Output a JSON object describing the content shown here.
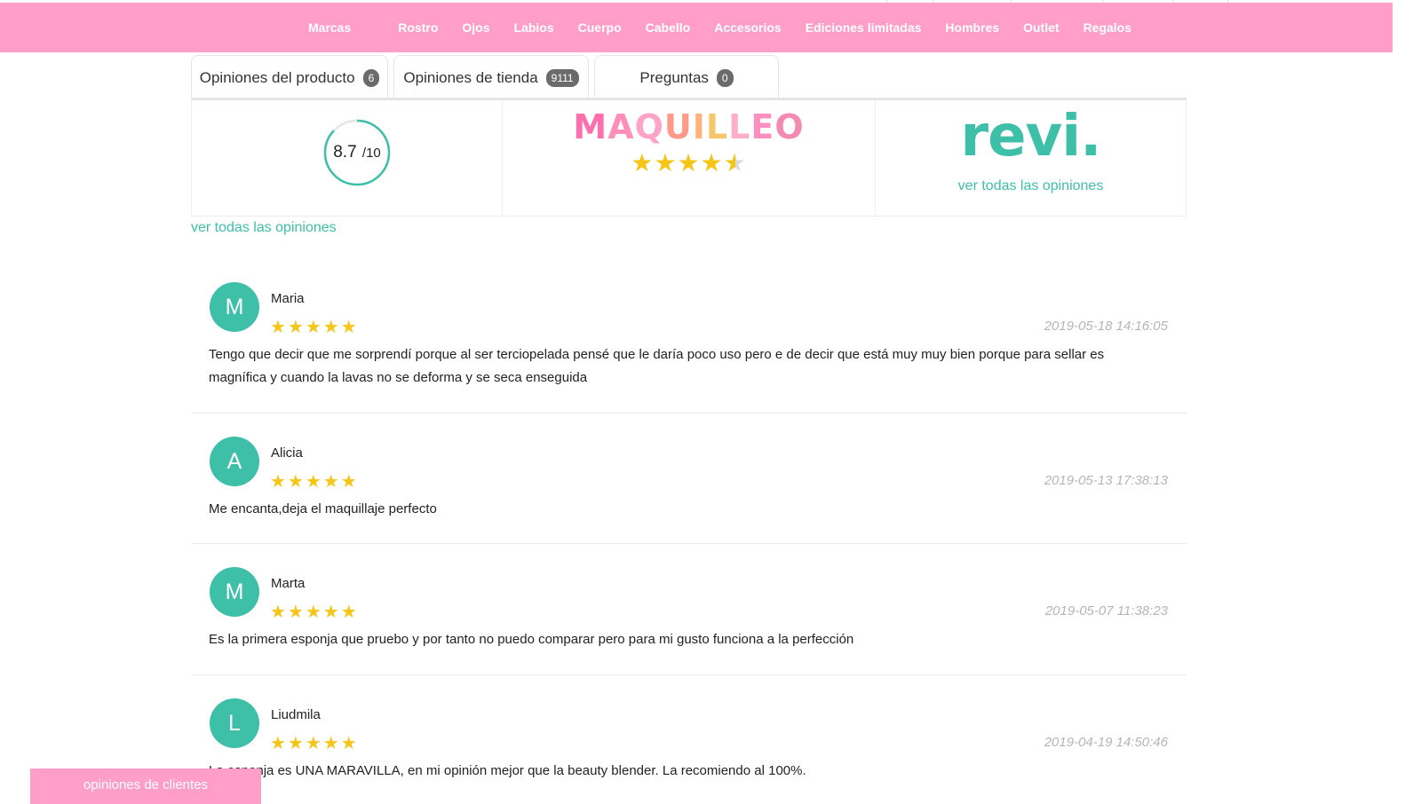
{
  "nav": {
    "items": [
      "Marcas",
      "Rostro",
      "Ojos",
      "Labios",
      "Cuerpo",
      "Cabello",
      "Accesorios",
      "Ediciones limitadas",
      "Hombres",
      "Outlet",
      "Regalos"
    ]
  },
  "tabs": [
    {
      "label": "Opiniones del producto",
      "count": "6"
    },
    {
      "label": "Opiniones de tienda",
      "count": "9111"
    },
    {
      "label": "Preguntas",
      "count": "0"
    }
  ],
  "summary": {
    "score": "8.7",
    "score_denominator": "/10",
    "score_fraction": 0.87,
    "brand_name": "MAQUILLEO",
    "brand_stars": 4.5,
    "revi_logo": "revi.",
    "revi_link": "ver todas las opiniones"
  },
  "all_link": "ver todas las opiniones",
  "reviews": [
    {
      "initial": "M",
      "name": "Maria",
      "stars": "★★★★★",
      "date": "2019-05-18 14:16:05",
      "text": "Tengo que decir que me sorprendí porque al ser terciopelada pensé que le daría poco uso pero e de decir que está muy muy bien porque para sellar es magnífica y cuando la lavas no se deforma y se seca enseguida"
    },
    {
      "initial": "A",
      "name": "Alicia",
      "stars": "★★★★★",
      "date": "2019-05-13 17:38:13",
      "text": "Me encanta,deja el maquillaje perfecto"
    },
    {
      "initial": "M",
      "name": "Marta",
      "stars": "★★★★★",
      "date": "2019-05-07 11:38:23",
      "text": "Es la primera esponja que pruebo y por tanto no puedo comparar pero para mi gusto funciona a la perfección"
    },
    {
      "initial": "L",
      "name": "Liudmila",
      "stars": "★★★★★",
      "date": "2019-04-19 14:50:46",
      "text": "La esponja es UNA MARAVILLA, en mi opinión mejor que la beauty blender. La recomiendo al 100%."
    }
  ],
  "bottom_tab": "opiniones de clientes",
  "colors": {
    "nav_bg": "#ff9ec9",
    "accent": "#3dbfa8",
    "star": "#f5c518"
  }
}
